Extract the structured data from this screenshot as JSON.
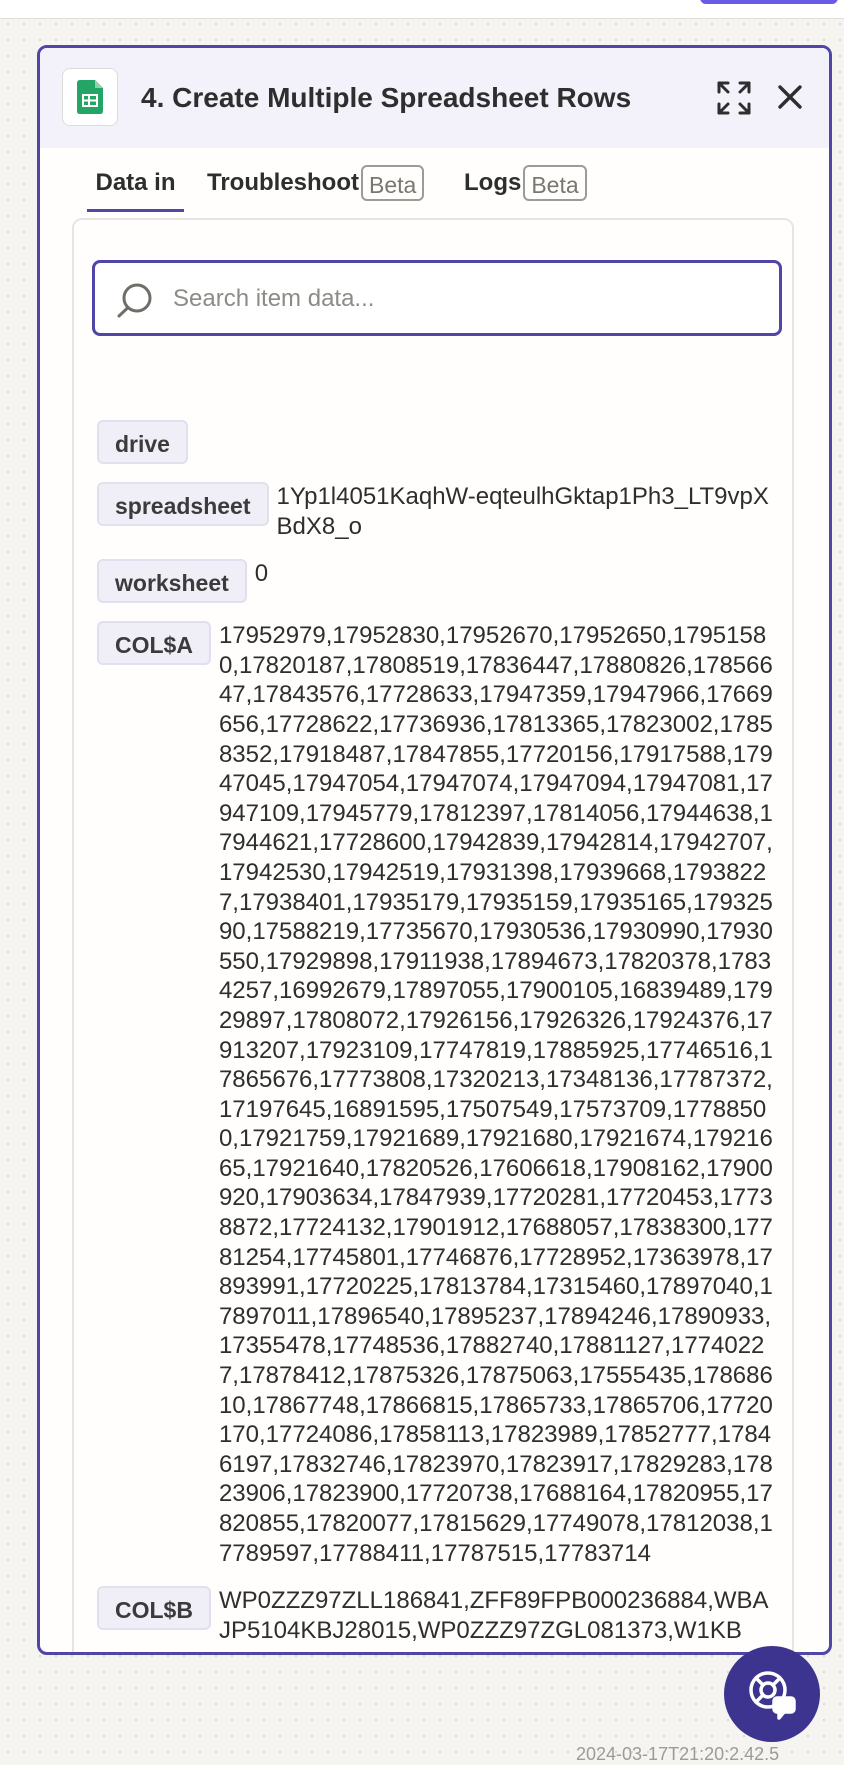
{
  "colors": {
    "accent": "#5046a8",
    "fab": "#3d348f",
    "key_badge_bg": "#f0eff7",
    "sheets_green": "#23a566"
  },
  "panel": {
    "app_icon": "google-sheets-icon",
    "title": "4. Create Multiple Spreadsheet Rows",
    "expand_icon": "expand-icon",
    "close_icon": "close-icon"
  },
  "tabs": [
    {
      "label": "Data in",
      "active": true
    },
    {
      "label": "Troubleshoot",
      "badge": "Beta"
    },
    {
      "label": "Logs",
      "badge": "Beta"
    }
  ],
  "search": {
    "placeholder": "Search item data...",
    "value": "",
    "icon": "search-icon"
  },
  "fields": [
    {
      "key": "drive",
      "value": ""
    },
    {
      "key": "spreadsheet",
      "value": "1Yp1l4051KaqhW-eqteulhGktap1Ph3_LT9vpXBdX8_o"
    },
    {
      "key": "worksheet",
      "value": "0"
    },
    {
      "key": "COL$A",
      "value": "17952979,17952830,17952670,17952650,17951580,17820187,17808519,17836447,17880826,17856647,17843576,17728633,17947359,17947966,17669656,17728622,17736936,17813365,17823002,17858352,17918487,17847855,17720156,17917588,17947045,17947054,17947074,17947094,17947081,17947109,17945779,17812397,17814056,17944638,17944621,17728600,17942839,17942814,17942707,17942530,17942519,17931398,17939668,17938227,17938401,17935179,17935159,17935165,17932590,17588219,17735670,17930536,17930990,17930550,17929898,17911938,17894673,17820378,17834257,16992679,17897055,17900105,16839489,17929897,17808072,17926156,17926326,17924376,17913207,17923109,17747819,17885925,17746516,17865676,17773808,17320213,17348136,17787372,17197645,16891595,17507549,17573709,17788500,17921759,17921689,17921680,17921674,17921665,17921640,17820526,17606618,17908162,17900920,17903634,17847939,17720281,17720453,17738872,17724132,17901912,17688057,17838300,17781254,17745801,17746876,17728952,17363978,17893991,17720225,17813784,17315460,17897040,17897011,17896540,17895237,17894246,17890933,17355478,17748536,17882740,17881127,17740227,17878412,17875326,17875063,17555435,17868610,17867748,17866815,17865733,17865706,17720170,17724086,17858113,17823989,17852777,17846197,17832746,17823970,17823917,17829283,17823906,17823900,17720738,17688164,17820955,17820855,17820077,17815629,17749078,17812038,17789597,17788411,17787515,17783714"
    },
    {
      "key": "COL$B",
      "value": "WP0ZZZ97ZLL186841,ZFF89FPB000236884,WBAJP5104KBJ28015,WP0ZZZ97ZGL081373,W1KB"
    }
  ],
  "help_button": {
    "icon": "help-chat-icon"
  },
  "timestamp_partial": "2024-03-17T21:20:2.42.5"
}
